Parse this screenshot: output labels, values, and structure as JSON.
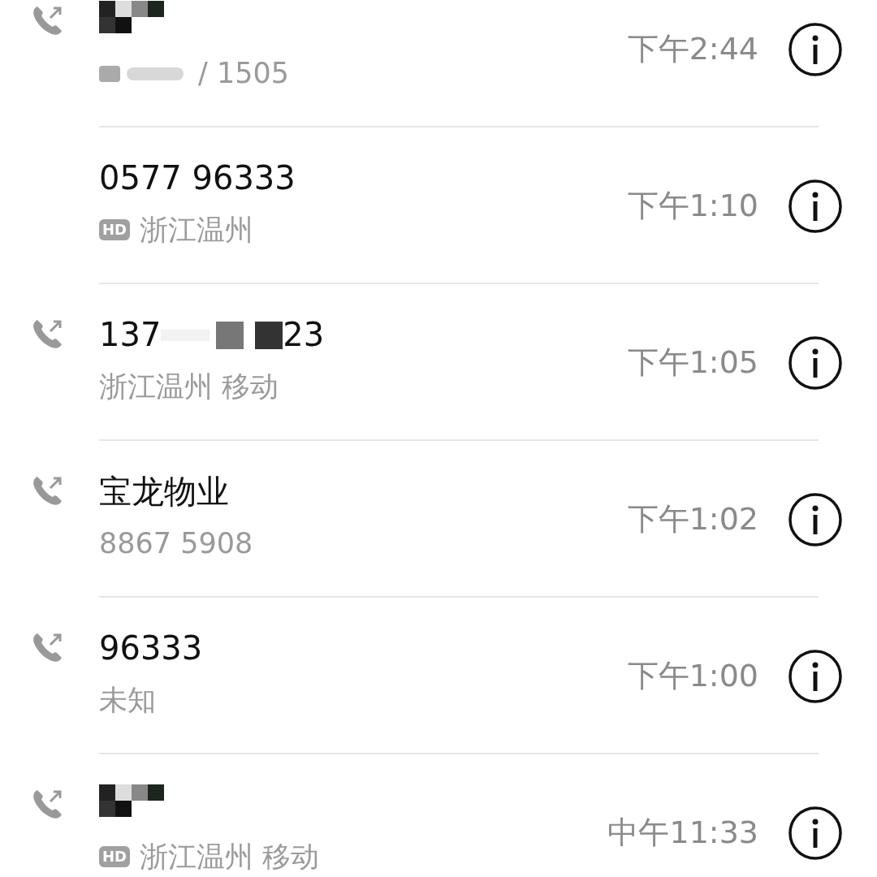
{
  "calls": [
    {
      "outgoing": true,
      "name": [
        {
          "kind": "redacted"
        }
      ],
      "badge_redacted": true,
      "subtitle": "/ 1505",
      "time": "下午2:44"
    },
    {
      "outgoing": false,
      "name": [
        {
          "kind": "text",
          "text": "0577 96333"
        }
      ],
      "badge": "HD",
      "subtitle": "浙江温州",
      "time": "下午1:10"
    },
    {
      "outgoing": true,
      "name": [
        {
          "kind": "text",
          "text": "137"
        },
        {
          "kind": "redacted"
        },
        {
          "kind": "text",
          "text": "23"
        }
      ],
      "subtitle": "浙江温州 移动",
      "time": "下午1:05"
    },
    {
      "outgoing": true,
      "name": [
        {
          "kind": "text",
          "text": "宝龙物业"
        }
      ],
      "subtitle": "8867 5908",
      "time": "下午1:02"
    },
    {
      "outgoing": true,
      "name": [
        {
          "kind": "text",
          "text": "96333"
        }
      ],
      "subtitle": "未知",
      "time": "下午1:00"
    },
    {
      "outgoing": true,
      "name": [
        {
          "kind": "redacted"
        }
      ],
      "badge": "HD",
      "subtitle": "浙江温州 移动",
      "time": "中午11:33"
    }
  ]
}
